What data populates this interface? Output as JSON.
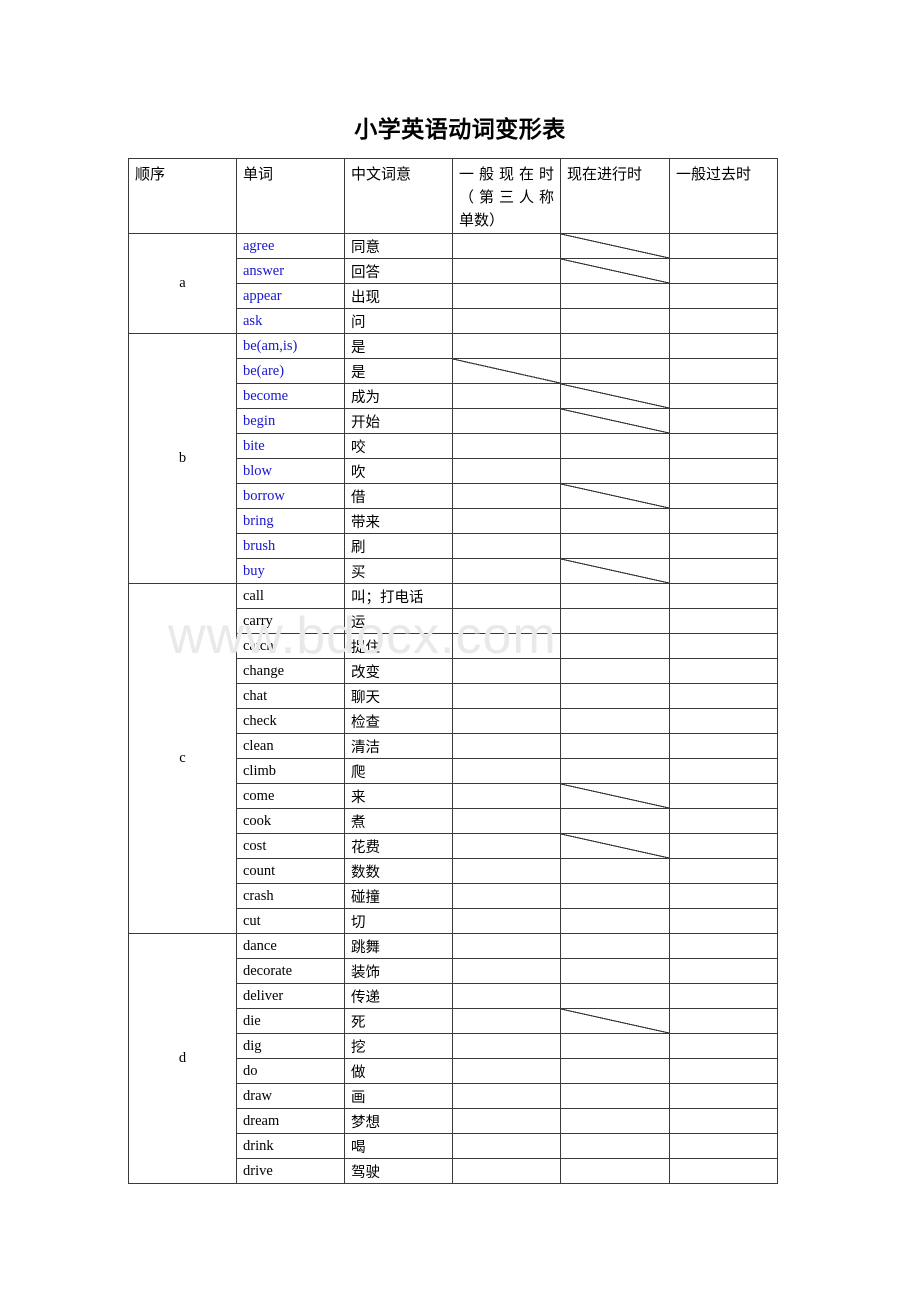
{
  "document": {
    "title": "小学英语动词变形表",
    "watermark": "www.bdocx.com",
    "blue_color": "#1717cf"
  },
  "table": {
    "headers": [
      "顺序",
      "单词",
      "中文词意",
      "一般现在时（第三人称单数）",
      "现在进行时",
      "一般过去时"
    ],
    "header_lines": {
      "t1_line1": "一般现在时",
      "t1_line2": "（第三人称",
      "t1_line3": "单数）"
    },
    "groups": [
      {
        "letter": "a",
        "color": "blue",
        "rows": [
          {
            "word": "agree",
            "meaning": "同意",
            "t1": "",
            "t2": "",
            "t3": "",
            "diag": "t2"
          },
          {
            "word": "answer",
            "meaning": "回答",
            "t1": "",
            "t2": "",
            "t3": "",
            "diag": "t2"
          },
          {
            "word": "appear",
            "meaning": "出现",
            "t1": "",
            "t2": "",
            "t3": "",
            "diag": ""
          },
          {
            "word": "ask",
            "meaning": "问",
            "t1": "",
            "t2": "",
            "t3": "",
            "diag": ""
          }
        ]
      },
      {
        "letter": "b",
        "color": "blue",
        "rows": [
          {
            "word": "be(am,is)",
            "meaning": "是",
            "t1": "",
            "t2": "",
            "t3": "",
            "diag": ""
          },
          {
            "word": "be(are)",
            "meaning": "是",
            "t1": "",
            "t2": "",
            "t3": "",
            "diag": "t1"
          },
          {
            "word": "become",
            "meaning": "成为",
            "t1": "",
            "t2": "",
            "t3": "",
            "diag": "t2"
          },
          {
            "word": "begin",
            "meaning": "开始",
            "t1": "",
            "t2": "",
            "t3": "",
            "diag": "t2"
          },
          {
            "word": "bite",
            "meaning": "咬",
            "t1": "",
            "t2": "",
            "t3": "",
            "diag": ""
          },
          {
            "word": "blow",
            "meaning": "吹",
            "t1": "",
            "t2": "",
            "t3": "",
            "diag": ""
          },
          {
            "word": "borrow",
            "meaning": "借",
            "t1": "",
            "t2": "",
            "t3": "",
            "diag": "t2"
          },
          {
            "word": "bring",
            "meaning": "带来",
            "t1": "",
            "t2": "",
            "t3": "",
            "diag": ""
          },
          {
            "word": "brush",
            "meaning": "刷",
            "t1": "",
            "t2": "",
            "t3": "",
            "diag": ""
          },
          {
            "word": "buy",
            "meaning": "买",
            "t1": "",
            "t2": "",
            "t3": "",
            "diag": "t2"
          }
        ]
      },
      {
        "letter": "c",
        "color": "black",
        "rows": [
          {
            "word": "call",
            "meaning": "叫；打电话",
            "t1": "",
            "t2": "",
            "t3": "",
            "diag": ""
          },
          {
            "word": "carry",
            "meaning": "运",
            "t1": "",
            "t2": "",
            "t3": "",
            "diag": ""
          },
          {
            "word": "catch",
            "meaning": "捉住",
            "t1": "",
            "t2": "",
            "t3": "",
            "diag": ""
          },
          {
            "word": "change",
            "meaning": "改变",
            "t1": "",
            "t2": "",
            "t3": "",
            "diag": ""
          },
          {
            "word": "chat",
            "meaning": "聊天",
            "t1": "",
            "t2": "",
            "t3": "",
            "diag": ""
          },
          {
            "word": "check",
            "meaning": "检查",
            "t1": "",
            "t2": "",
            "t3": "",
            "diag": ""
          },
          {
            "word": "clean",
            "meaning": "清洁",
            "t1": "",
            "t2": "",
            "t3": "",
            "diag": ""
          },
          {
            "word": "climb",
            "meaning": "爬",
            "t1": "",
            "t2": "",
            "t3": "",
            "diag": ""
          },
          {
            "word": "come",
            "meaning": "来",
            "t1": "",
            "t2": "",
            "t3": "",
            "diag": "t2"
          },
          {
            "word": "cook",
            "meaning": "煮",
            "t1": "",
            "t2": "",
            "t3": "",
            "diag": ""
          },
          {
            "word": "cost",
            "meaning": "花费",
            "t1": "",
            "t2": "",
            "t3": "",
            "diag": "t2"
          },
          {
            "word": "count",
            "meaning": "数数",
            "t1": "",
            "t2": "",
            "t3": "",
            "diag": ""
          },
          {
            "word": "crash",
            "meaning": "碰撞",
            "t1": "",
            "t2": "",
            "t3": "",
            "diag": ""
          },
          {
            "word": "cut",
            "meaning": "切",
            "t1": "",
            "t2": "",
            "t3": "",
            "diag": ""
          }
        ]
      },
      {
        "letter": "d",
        "color": "black",
        "rows": [
          {
            "word": "dance",
            "meaning": "跳舞",
            "t1": "",
            "t2": "",
            "t3": "",
            "diag": ""
          },
          {
            "word": "decorate",
            "meaning": "装饰",
            "t1": "",
            "t2": "",
            "t3": "",
            "diag": ""
          },
          {
            "word": "deliver",
            "meaning": "传递",
            "t1": "",
            "t2": "",
            "t3": "",
            "diag": ""
          },
          {
            "word": "die",
            "meaning": "死",
            "t1": "",
            "t2": "",
            "t3": "",
            "diag": "t2"
          },
          {
            "word": "dig",
            "meaning": "挖",
            "t1": "",
            "t2": "",
            "t3": "",
            "diag": ""
          },
          {
            "word": "do",
            "meaning": "做",
            "t1": "",
            "t2": "",
            "t3": "",
            "diag": ""
          },
          {
            "word": "draw",
            "meaning": "画",
            "t1": "",
            "t2": "",
            "t3": "",
            "diag": ""
          },
          {
            "word": "dream",
            "meaning": "梦想",
            "t1": "",
            "t2": "",
            "t3": "",
            "diag": ""
          },
          {
            "word": "drink",
            "meaning": "喝",
            "t1": "",
            "t2": "",
            "t3": "",
            "diag": ""
          },
          {
            "word": "drive",
            "meaning": "驾驶",
            "t1": "",
            "t2": "",
            "t3": "",
            "diag": ""
          }
        ]
      }
    ]
  }
}
